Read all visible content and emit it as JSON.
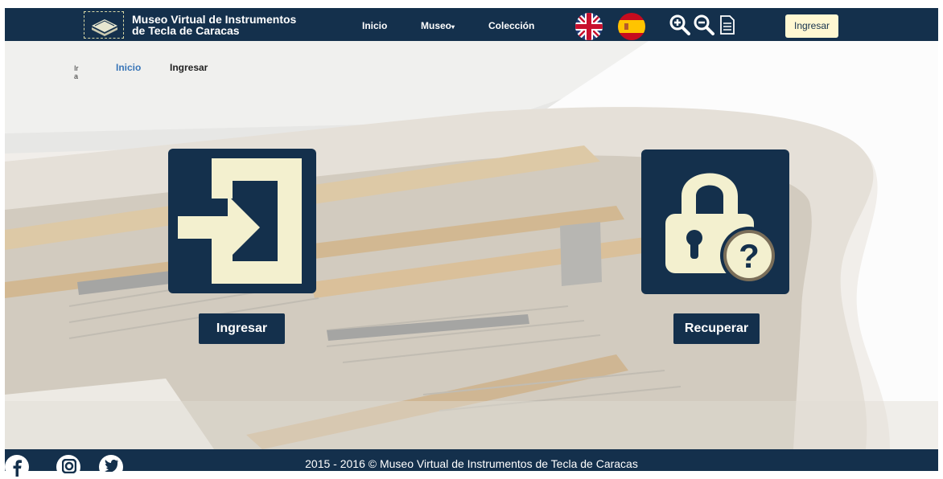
{
  "brand": {
    "line1": "Museo Virtual de Instrumentos",
    "line2": "de Tecla de Caracas",
    "logo_icon": "book-icon"
  },
  "nav": {
    "inicio": "Inicio",
    "museo": "Museo",
    "museo_caret": "▾",
    "coleccion": "Colección"
  },
  "languages": [
    "english-flag",
    "spanish-flag"
  ],
  "tools": [
    "zoom-in-icon",
    "zoom-out-icon",
    "document-icon"
  ],
  "header_login": "Ingresar",
  "breadcrumb": {
    "prefix": "Ir a",
    "link": "Inicio",
    "current": "Ingresar"
  },
  "cards": {
    "login": {
      "label": "Ingresar",
      "icon": "login-icon"
    },
    "recover": {
      "label": "Recuperar",
      "icon": "lock-question-icon"
    }
  },
  "footer": {
    "copyright": "2015 - 2016 © Museo Virtual de Instrumentos de Tecla de Caracas",
    "social": [
      "facebook-icon",
      "instagram-icon",
      "twitter-icon"
    ]
  },
  "colors": {
    "navy": "#14304c",
    "cream": "#fff8d2",
    "link": "#3a76b8"
  }
}
